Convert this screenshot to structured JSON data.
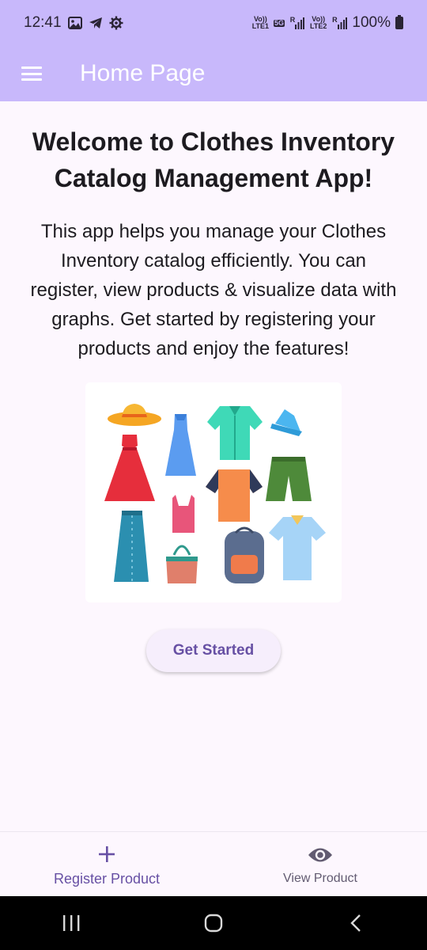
{
  "status_bar": {
    "time": "12:41",
    "battery": "100%",
    "left_icons": [
      "image-icon",
      "telegram-icon",
      "settings-gear-icon"
    ],
    "right_icons": [
      "volte-lte1-icon",
      "5g-signal-icon",
      "volte-lte2-icon",
      "battery-icon"
    ],
    "sim1_tag_top": "Vo))",
    "sim1_tag_bottom": "LTE1",
    "sim2_tag_top": "Vo))",
    "sim2_tag_bottom": "LTE2",
    "network_5g": "5G",
    "roaming": "R"
  },
  "app_bar": {
    "title": "Home Page",
    "menu_icon": "hamburger-menu-icon",
    "background": "#c8b8fb"
  },
  "main": {
    "heading": "Welcome to Clothes Inventory Catalog Management App!",
    "description": "This app helps you manage your Clothes Inventory catalog efficiently. You can register, view products & visualize data with graphs. Get started by registering your products and enjoy the features!",
    "illustration": "clothes-collection-image",
    "cta_label": "Get Started"
  },
  "bottom_nav": {
    "items": [
      {
        "label": "Register Product",
        "icon": "plus-icon",
        "active": true
      },
      {
        "label": "View Product",
        "icon": "eye-icon",
        "active": false
      }
    ]
  },
  "system_nav": {
    "buttons": [
      "recents-icon",
      "home-icon",
      "back-icon"
    ]
  },
  "colors": {
    "accent": "#6750a4",
    "app_bar": "#c8b8fb",
    "background": "#fdf7fe"
  }
}
